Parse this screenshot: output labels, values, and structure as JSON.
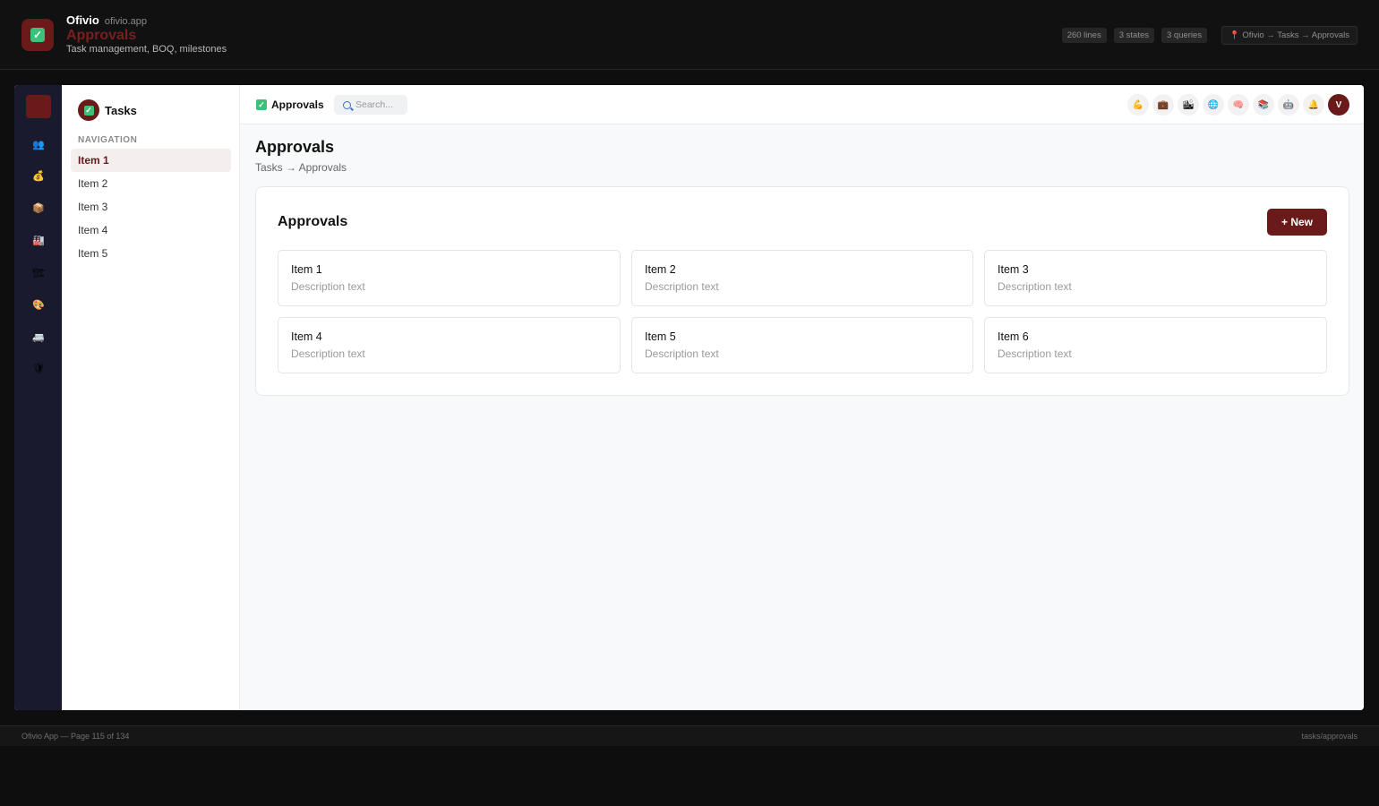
{
  "header": {
    "brand": "Ofivio",
    "domain": "ofivio.app",
    "page_name": "Approvals",
    "description": "Task management, BOQ, milestones",
    "chips": [
      "260 lines",
      "3 states",
      "3 queries"
    ],
    "path": "Ofivio → Tasks → Approvals"
  },
  "rail": {
    "icons": [
      {
        "name": "users-icon",
        "glyph": "👥"
      },
      {
        "name": "money-bag-icon",
        "glyph": "💰"
      },
      {
        "name": "package-icon",
        "glyph": "📦"
      },
      {
        "name": "factory-icon",
        "glyph": "🏭"
      },
      {
        "name": "construction-icon",
        "glyph": "🏗"
      },
      {
        "name": "palette-icon",
        "glyph": "🎨"
      },
      {
        "name": "vehicle-icon",
        "glyph": "🚐"
      },
      {
        "name": "shield-icon",
        "glyph": "🛡"
      }
    ]
  },
  "sidebar": {
    "title": "Tasks",
    "section": "NAVIGATION",
    "items": [
      "Item 1",
      "Item 2",
      "Item 3",
      "Item 4",
      "Item 5"
    ]
  },
  "topbar": {
    "title": "Approvals",
    "search_placeholder": "Search...",
    "icons": [
      {
        "name": "strength-icon",
        "glyph": "💪"
      },
      {
        "name": "briefcase-icon",
        "glyph": "💼"
      },
      {
        "name": "buildings-icon",
        "glyph": "🏙"
      },
      {
        "name": "globe-icon",
        "glyph": "🌐"
      },
      {
        "name": "brain-icon",
        "glyph": "🧠"
      },
      {
        "name": "books-icon",
        "glyph": "📚"
      },
      {
        "name": "robot-icon",
        "glyph": "🤖"
      },
      {
        "name": "bell-icon",
        "glyph": "🔔"
      }
    ],
    "user_initial": "V"
  },
  "main": {
    "title": "Approvals",
    "breadcrumb": "Tasks → Approvals",
    "card": {
      "title": "Approvals",
      "new_button": "+ New",
      "items": [
        {
          "name": "Item 1",
          "desc": "Description text"
        },
        {
          "name": "Item 2",
          "desc": "Description text"
        },
        {
          "name": "Item 3",
          "desc": "Description text"
        },
        {
          "name": "Item 4",
          "desc": "Description text"
        },
        {
          "name": "Item 5",
          "desc": "Description text"
        },
        {
          "name": "Item 6",
          "desc": "Description text"
        }
      ]
    }
  },
  "footer": {
    "left": "Ofivio App — Page 115 of 134",
    "right": "tasks/approvals"
  },
  "colors": {
    "brand": "#6b1a1a",
    "rail_bg": "#1a1a2e",
    "check_green": "#3ec07a"
  }
}
